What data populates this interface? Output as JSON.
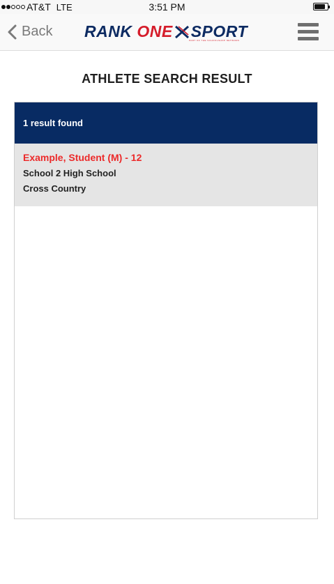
{
  "status_bar": {
    "carrier": "AT&T",
    "network": "LTE",
    "time": "3:51 PM",
    "signal_strength": 2,
    "signal_max": 5,
    "battery_level": 0.85
  },
  "nav": {
    "back_label": "Back",
    "logo": {
      "part1": "RANK ",
      "part2": "ONE",
      "part3": "SPORT",
      "tagline": "PART OF THE SCHOOLSHOP NETWORK"
    },
    "menu_icon": "hamburger-icon"
  },
  "page": {
    "title": "ATHLETE SEARCH RESULT"
  },
  "results": {
    "count_text": "1 result found",
    "items": [
      {
        "name": "Example, Student (M) - 12",
        "school": "School 2 High School",
        "sport": "Cross Country"
      }
    ]
  },
  "colors": {
    "brand_navy": "#082b63",
    "brand_red": "#d51d2b",
    "result_name": "#ec2a2a",
    "result_bg": "#e5e5e5"
  }
}
